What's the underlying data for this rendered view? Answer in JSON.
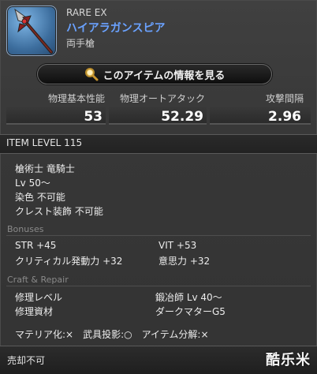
{
  "header": {
    "rarity": "RARE EX",
    "name": "ハイアラガンスピア",
    "category": "両手槍",
    "name_color": "#6aa2ff"
  },
  "info_button": {
    "label": "このアイテムの情報を見る",
    "icon": "magnifier-icon"
  },
  "stats": [
    {
      "label": "物理基本性能",
      "value": "53"
    },
    {
      "label": "物理オートアタック",
      "value": "52.29"
    },
    {
      "label": "攻撃間隔",
      "value": "2.96"
    }
  ],
  "item_level": "ITEM LEVEL 115",
  "requirements": {
    "jobs": "槍術士 竜騎士",
    "level": "Lv 50～",
    "dye": "染色 不可能",
    "crest": "クレスト装飾 不可能"
  },
  "bonuses": {
    "heading": "Bonuses",
    "items": [
      "STR +45",
      "VIT +53",
      "クリティカル発動力 +32",
      "意思力 +32"
    ]
  },
  "craft": {
    "heading": "Craft & Repair",
    "repair_level_label": "修理レベル",
    "repair_level_value": "鍛冶師 Lv 40～",
    "repair_material_label": "修理資材",
    "repair_material_value": "ダークマターG5",
    "flags": "マテリア化:×　武具投影:○　アイテム分解:×"
  },
  "footer": {
    "sell": "売却不可",
    "watermark": "酷乐米"
  }
}
